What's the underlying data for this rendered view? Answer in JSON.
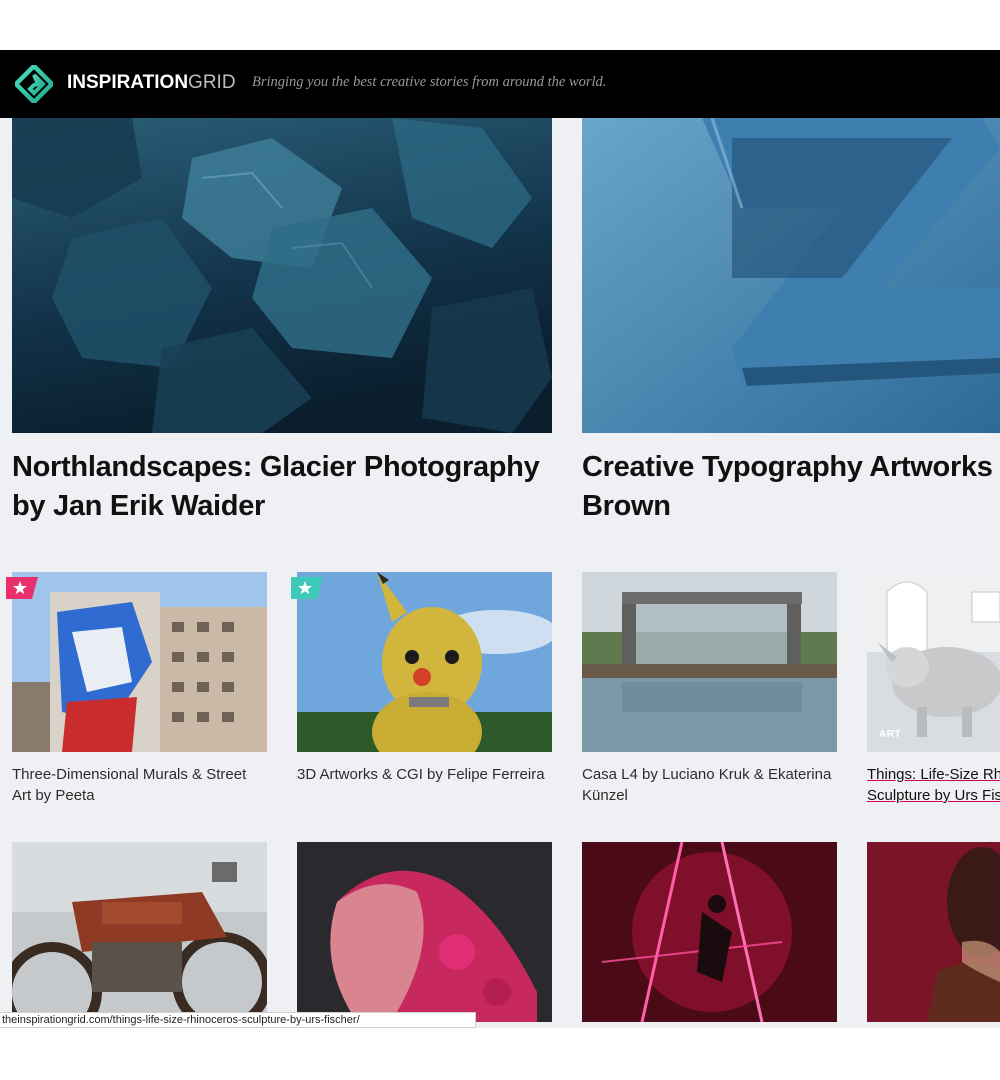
{
  "header": {
    "logo_bold": "INSPIRATION",
    "logo_thin": "GRID",
    "tagline": "Bringing you the best creative stories from around the world."
  },
  "features": [
    {
      "title_line1": "Northlandscapes: Glacier Photography",
      "title_line2": "by Jan Erik Waider"
    },
    {
      "title_line1": "Creative Typography Artworks by",
      "title_line2": "Brown"
    }
  ],
  "cards": [
    {
      "title": "Three-Dimensional Murals & Street Art by Peeta"
    },
    {
      "title": "3D Artworks & CGI by Felipe Ferreira"
    },
    {
      "title": "Casa L4 by Luciano Kruk & Ekaterina Künzel"
    },
    {
      "title_line1": "Things: Life-Size Rhinoceros",
      "title_line2": "Sculpture by Urs Fischer",
      "tag": "ART"
    }
  ],
  "status_bar": {
    "url": "theinspirationgrid.com/things-life-size-rhinoceros-sculpture-by-urs-fischer/"
  },
  "colors": {
    "brand_teal": "#2ec4a6",
    "badge_pink": "#e8306a",
    "badge_teal": "#3fc9b8",
    "link_underline": "#d6005a"
  }
}
